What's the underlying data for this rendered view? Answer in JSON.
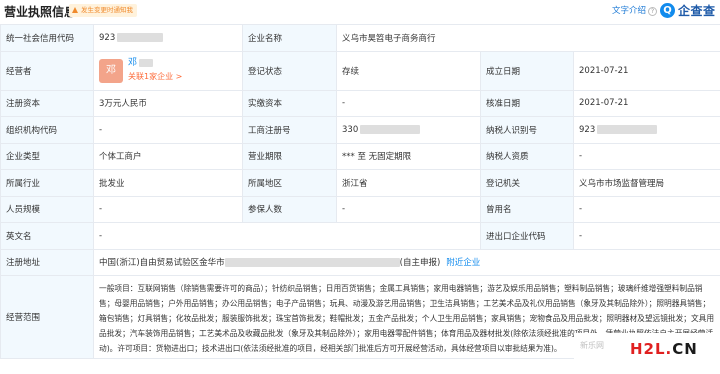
{
  "header": {
    "title": "营业执照信息",
    "notice": "发生变更时通知我",
    "intro_link": "文字介绍",
    "logo_text": "企查查"
  },
  "labels": {
    "credit_code": "统一社会信用代码",
    "company_name": "企业名称",
    "legal_person": "经营者",
    "reg_status": "登记状态",
    "founded": "成立日期",
    "reg_capital": "注册资本",
    "paid_capital": "实缴资本",
    "approved": "核准日期",
    "org_code": "组织机构代码",
    "reg_no": "工商注册号",
    "taxpayer_id": "纳税人识别号",
    "type": "企业类型",
    "term": "营业期限",
    "taxpayer_qual": "纳税人资质",
    "industry": "所属行业",
    "region": "所属地区",
    "authority": "登记机关",
    "staff": "人员规模",
    "insured": "参保人数",
    "former_name": "曾用名",
    "english_name": "英文名",
    "ie_code": "进出口企业代码",
    "address": "注册地址",
    "scope": "经营范围"
  },
  "values": {
    "credit_code": "923",
    "company_name": "义乌市昊笤电子商务商行",
    "person_avatar": "邓",
    "person_name": "邓",
    "person_related": "关联1家企业 >",
    "reg_status": "存续",
    "founded": "2021-07-21",
    "reg_capital": "3万元人民币",
    "paid_capital": "-",
    "approved": "2021-07-21",
    "org_code": "-",
    "reg_no": "330",
    "taxpayer_id": "923",
    "type": "个体工商户",
    "term": "*** 至 无固定期限",
    "taxpayer_qual": "-",
    "industry": "批发业",
    "region": "浙江省",
    "authority": "义乌市市场监督管理局",
    "staff": "-",
    "insured": "-",
    "former_name": "-",
    "english_name": "-",
    "ie_code": "-",
    "address_prefix": "中国(浙江)自由贸易试验区金华市",
    "address_suffix": "(自主申报)",
    "nearby_link": "附近企业",
    "scope": "一般项目：互联网销售（除销售需要许可的商品）；针纺织品销售；日用百货销售；金属工具销售；家用电器销售；游艺及娱乐用品销售；塑料制品销售；玻璃纤维增强塑料制品销售；母婴用品销售；户外用品销售；办公用品销售；电子产品销售；玩具、动漫及游艺用品销售；卫生洁具销售；工艺美术品及礼仪用品销售（象牙及其制品除外）；照明器具销售；箱包销售；灯具销售；化妆品批发；服装服饰批发；珠宝首饰批发；鞋帽批发；五金产品批发；个人卫生用品销售；家具销售；宠物食品及用品批发；照明器材及望远镜批发；文具用品批发；汽车装饰用品销售；工艺美术品及收藏品批发（象牙及其制品除外）；家用电器零配件销售；体育用品及器材批发(除依法须经批准的项目外，凭营业执照依法自主开展经营活动)。许可项目：货物进出口；技术进出口(依法须经批准的项目，经相关部门批准后方可开展经营活动，具体经营项目以审批结果为准)。"
  },
  "watermark": {
    "brand": "H2L.CN",
    "brand_main": "H2L.",
    "brand_cn": "CN",
    "faint": "新乐网"
  }
}
